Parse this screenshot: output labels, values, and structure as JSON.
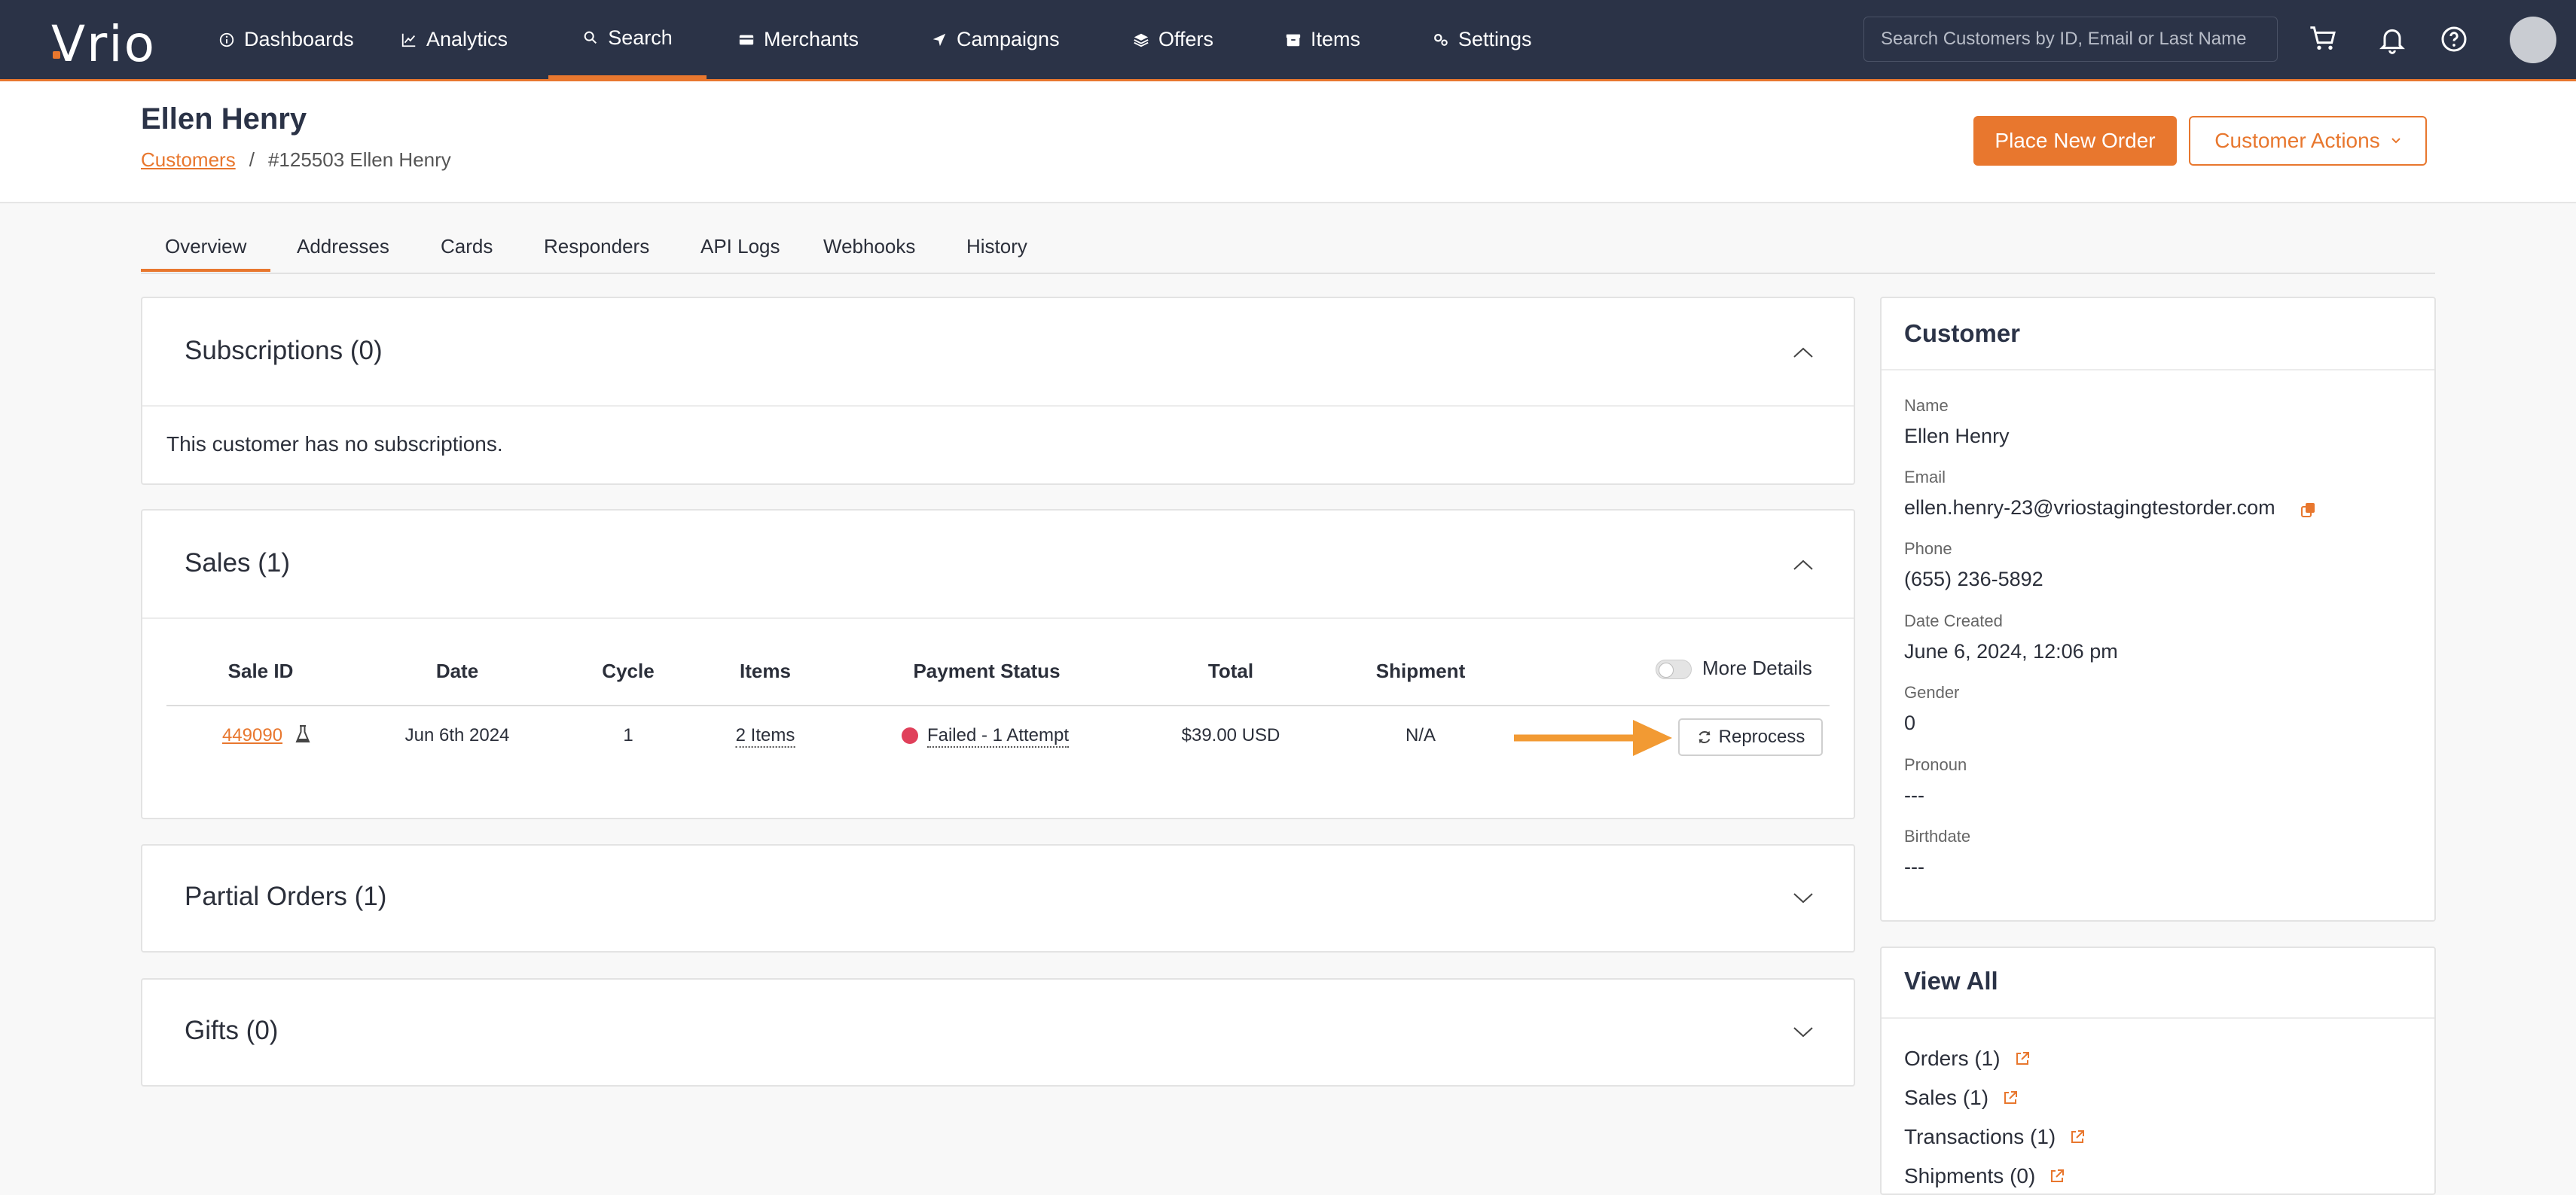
{
  "nav": {
    "logo": "Vrio",
    "items": [
      {
        "label": "Dashboards",
        "icon": "info-circle-icon"
      },
      {
        "label": "Analytics",
        "icon": "line-chart-icon"
      },
      {
        "label": "Search",
        "icon": "search-icon",
        "active": true
      },
      {
        "label": "Merchants",
        "icon": "credit-card-icon"
      },
      {
        "label": "Campaigns",
        "icon": "paper-plane-icon"
      },
      {
        "label": "Offers",
        "icon": "layers-icon"
      },
      {
        "label": "Items",
        "icon": "box-icon"
      },
      {
        "label": "Settings",
        "icon": "gears-icon"
      }
    ],
    "search_placeholder": "Search Customers by ID, Email or Last Name"
  },
  "header": {
    "title": "Ellen Henry",
    "breadcrumb_link": "Customers",
    "breadcrumb_sep": "/",
    "breadcrumb_current": "#125503 Ellen Henry",
    "place_order": "Place New Order",
    "customer_actions": "Customer Actions"
  },
  "tabs": [
    "Overview",
    "Addresses",
    "Cards",
    "Responders",
    "API Logs",
    "Webhooks",
    "History"
  ],
  "subscriptions": {
    "title": "Subscriptions (0)",
    "empty": "This customer has no subscriptions."
  },
  "sales": {
    "title": "Sales (1)",
    "columns": [
      "Sale ID",
      "Date",
      "Cycle",
      "Items",
      "Payment Status",
      "Total",
      "Shipment"
    ],
    "more_details": "More Details",
    "rows": [
      {
        "sale_id": "449090",
        "date": "Jun 6th 2024",
        "cycle": "1",
        "items": "2 Items",
        "payment_status": "Failed - 1 Attempt",
        "total": "$39.00 USD",
        "shipment": "N/A"
      }
    ],
    "reprocess": "Reprocess",
    "status_color": "#e0405a"
  },
  "partial_orders": {
    "title": "Partial Orders (1)"
  },
  "gifts": {
    "title": "Gifts (0)"
  },
  "customer": {
    "title": "Customer",
    "fields": [
      {
        "label": "Name",
        "value": "Ellen Henry"
      },
      {
        "label": "Email",
        "value": "ellen.henry-23@vriostagingtestorder.com"
      },
      {
        "label": "Phone",
        "value": "(655) 236-5892"
      },
      {
        "label": "Date Created",
        "value": "June 6, 2024, 12:06 pm"
      },
      {
        "label": "Gender",
        "value": "0"
      },
      {
        "label": "Pronoun",
        "value": "---"
      },
      {
        "label": "Birthdate",
        "value": "---"
      }
    ]
  },
  "view_all": {
    "title": "View All",
    "links": [
      "Orders (1)",
      "Sales (1)",
      "Transactions (1)",
      "Shipments (0)"
    ]
  },
  "colors": {
    "accent": "#e8772e",
    "nav_bg": "#2b3347"
  }
}
